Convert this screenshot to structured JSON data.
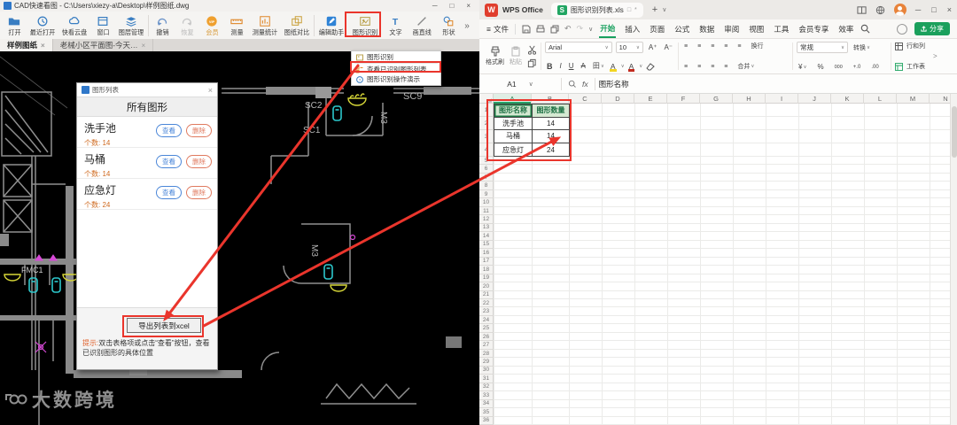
{
  "icons": {
    "close": "×",
    "minimize": "─",
    "maximize": "□",
    "chevron_down": "∨",
    "more": "»",
    "undo": "↶",
    "redo": "↷",
    "menu_burger": "≡",
    "plus": "+",
    "asterisk": "*",
    "square": "□",
    "fx": "fx",
    "corner": "◢",
    "align": "≡",
    "currency": "¥",
    "percent": "%",
    "thousands": "000",
    "inc_decimal": "+.0",
    "dec_decimal": ".00",
    "bold": "B",
    "italic": "I",
    "underline": "U",
    "strike": "A",
    "border_grid": "田",
    "expand": ">",
    "text_tool": "T"
  },
  "cad": {
    "title": "CAD快速看图 - C:\\Users\\xiezy-a\\Desktop\\样例图纸.dwg",
    "toolbar": [
      {
        "label": "打开"
      },
      {
        "label": "最近打开"
      },
      {
        "label": "快看云盘"
      },
      {
        "label": "窗口"
      },
      {
        "label": "图层管理"
      },
      {
        "label": "撤销"
      },
      {
        "label": "恢复"
      },
      {
        "label": "会员"
      },
      {
        "label": "测量"
      },
      {
        "label": "测量统计"
      },
      {
        "label": "图纸对比"
      },
      {
        "label": "编辑助手"
      },
      {
        "label": "图形识别"
      },
      {
        "label": "文字"
      },
      {
        "label": "画直线"
      },
      {
        "label": "形状"
      }
    ],
    "tabs": [
      {
        "label": "样例图纸"
      },
      {
        "label": "老械小区平面图-今天…"
      }
    ],
    "context_menu": [
      {
        "label": "图形识别"
      },
      {
        "label": "查看已识别图形列表"
      },
      {
        "label": "图形识别操作演示"
      }
    ],
    "dialog": {
      "title": "图形列表",
      "header": "所有图形",
      "count_prefix": "个数: ",
      "view_label": "查看",
      "delete_label": "删除",
      "items": [
        {
          "name": "洗手池",
          "count": "14"
        },
        {
          "name": "马桶",
          "count": "14"
        },
        {
          "name": "应急灯",
          "count": "24"
        }
      ],
      "export_label": "导出列表到xcel",
      "hint_prefix": "提示:",
      "hint_text": "双击表格项或点击“查看”按钮，查看已识别图形的具体位置"
    },
    "drawing_labels": [
      {
        "text": "SC9"
      },
      {
        "text": "SC2"
      },
      {
        "text": "SC1"
      },
      {
        "text": "M3"
      },
      {
        "text": "M3"
      },
      {
        "text": "FMC1"
      }
    ],
    "watermark": "大数跨境"
  },
  "wps": {
    "brand": "WPS Office",
    "doc_tab": "图形识别列表.xls",
    "file_menu": "文件",
    "menus": [
      "开始",
      "插入",
      "页面",
      "公式",
      "数据",
      "审阅",
      "视图",
      "工具",
      "会员专享",
      "效率"
    ],
    "active_menu": "开始",
    "share_label": "分享",
    "ribbon": {
      "format_painter": "格式刷",
      "paste": "粘贴",
      "font_name": "Arial",
      "font_size": "10",
      "wrap_label": "换行",
      "merge_label": "合并",
      "number_format": "常规",
      "convert_label": "转换",
      "rows_cols_label": "行和列",
      "worksheet_label": "工作表"
    },
    "name_box": "A1",
    "formula": "图形名称",
    "columns": [
      "A",
      "B",
      "C",
      "D",
      "E",
      "F",
      "G",
      "H",
      "I",
      "J",
      "K",
      "L",
      "M",
      "N"
    ],
    "rows_visible": 36,
    "sheet": {
      "headers": [
        "图形名称",
        "图形数量"
      ],
      "rows": [
        [
          "洗手池",
          "14"
        ],
        [
          "马桶",
          "14"
        ],
        [
          "应急灯",
          "24"
        ]
      ]
    }
  },
  "annotations": {
    "color": "#ea352c"
  }
}
